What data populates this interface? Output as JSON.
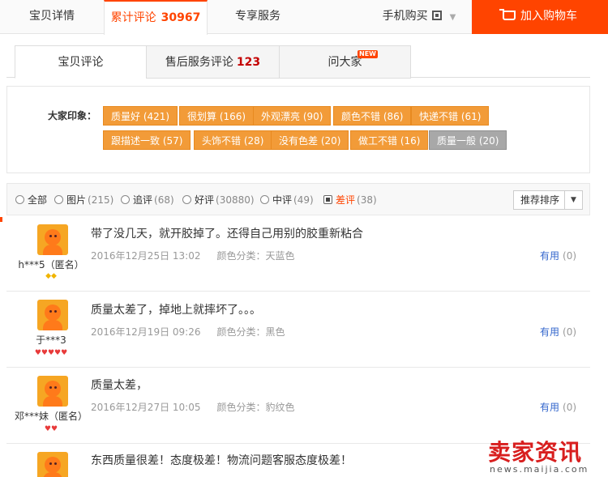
{
  "topbar": {
    "tab_detail": "宝贝详情",
    "tab_reviews": "累计评论",
    "tab_reviews_count": "30967",
    "tab_service": "专享服务",
    "mobile_buy": "手机购买",
    "add_to_cart": "加入购物车"
  },
  "subtabs": {
    "reviews": "宝贝评论",
    "after_sales": "售后服务评论",
    "after_sales_count": "123",
    "ask_all": "问大家",
    "new_badge": "NEW"
  },
  "impressions": {
    "label": "大家印象：",
    "tags": [
      "质量好 (421)",
      "很划算 (166)",
      "外观漂亮 (90)",
      "颜色不错 (86)",
      "快递不错 (61)",
      "跟描述一致 (57)",
      "头饰不错 (28)",
      "没有色差 (20)",
      "做工不错 (16)",
      "质量一般 (20)"
    ]
  },
  "filter": {
    "all": "全部",
    "pics": "图片",
    "pics_count": "(215)",
    "followup": "追评",
    "followup_count": "(68)",
    "good": "好评",
    "good_count": "(30880)",
    "medium": "中评",
    "medium_count": "(49)",
    "bad": "差评",
    "bad_count": "(38)",
    "sort": "推荐排序"
  },
  "reviews": [
    {
      "user": "h***5（匿名）",
      "level": "◆◆",
      "content": "带了没几天，就开胶掉了。还得自己用别的胶重新粘合",
      "date": "2016年12月25日 13:02",
      "color": "颜色分类：天蓝色",
      "useful": "有用",
      "useful_count": "(0)"
    },
    {
      "user": "于***3",
      "level": "♥♥♥♥♥",
      "content": "质量太差了，掉地上就摔坏了。。。",
      "date": "2016年12月19日 09:26",
      "color": "颜色分类：黑色",
      "useful": "有用",
      "useful_count": "(0)"
    },
    {
      "user": "邓***妹（匿名）",
      "level": "♥♥",
      "content": "质量太差，",
      "date": "2016年12月27日 10:05",
      "color": "颜色分类：豹纹色",
      "useful": "有用",
      "useful_count": "(0)"
    },
    {
      "user": "",
      "level": "",
      "content": "东西质量很差！态度极差！物流问题客服态度极差！",
      "date": "",
      "color": "",
      "useful": "",
      "useful_count": ""
    }
  ],
  "watermark": {
    "big": "卖家资讯",
    "small": "news.maijia.com"
  }
}
